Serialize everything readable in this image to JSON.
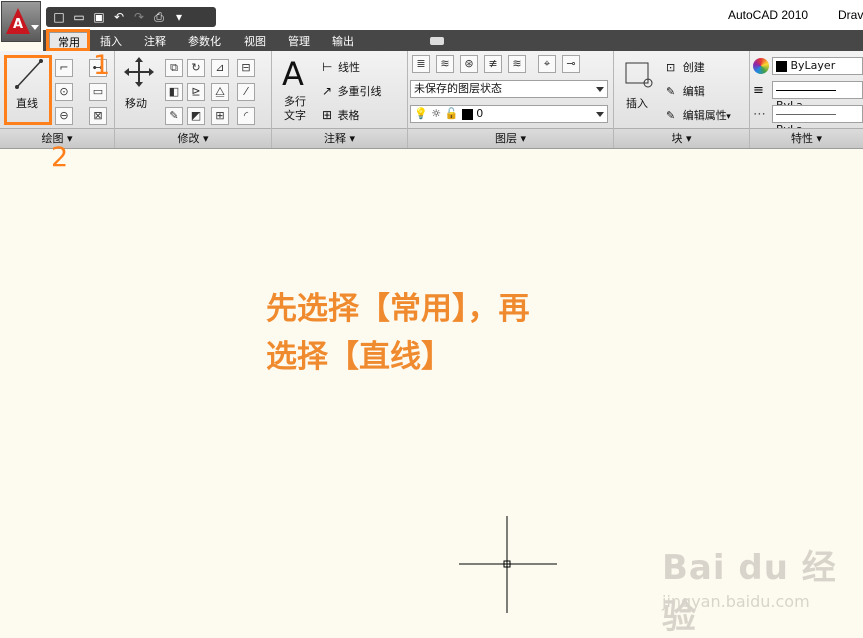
{
  "window": {
    "title": "AutoCAD 2010",
    "title_truncated": "Drav"
  },
  "app_button": {
    "letter": "A"
  },
  "tabs": [
    {
      "label": "常用",
      "active": true
    },
    {
      "label": "插入"
    },
    {
      "label": "注释"
    },
    {
      "label": "参数化"
    },
    {
      "label": "视图"
    },
    {
      "label": "管理"
    },
    {
      "label": "输出"
    }
  ],
  "panels": {
    "draw": {
      "title": "绘图",
      "line_label": "直线"
    },
    "modify": {
      "title": "修改",
      "move_label": "移动"
    },
    "annotation": {
      "title": "注释",
      "mtext_label_1": "多行",
      "mtext_label_2": "文字",
      "text_glyph": "A",
      "linear_label": "线性",
      "mleader_label": "多重引线",
      "table_label": "表格"
    },
    "layers": {
      "title": "图层",
      "layer_state": "未保存的图层状态",
      "current_layer": "0"
    },
    "block": {
      "title": "块",
      "insert_label": "插入",
      "create_label": "创建",
      "edit_label": "编辑",
      "edit_attr_label": "编辑属性"
    },
    "properties": {
      "title": "特性",
      "color_value": "ByLayer",
      "linetype_value": "ByLa",
      "lineweight_value": "ByLa"
    }
  },
  "annotations": {
    "step_1": "1",
    "step_2": "2",
    "instruction_line_1": "先选择【常用】，再",
    "instruction_line_2": "选择【直线】"
  },
  "watermark": {
    "brand": "Bai du 经验",
    "url": "jingyan.baidu.com"
  },
  "colors": {
    "highlight": "#ff7f1a",
    "instruction_text": "#f08a2e",
    "canvas_bg": "#fdfbf0",
    "tabbar_bg": "#474747"
  }
}
